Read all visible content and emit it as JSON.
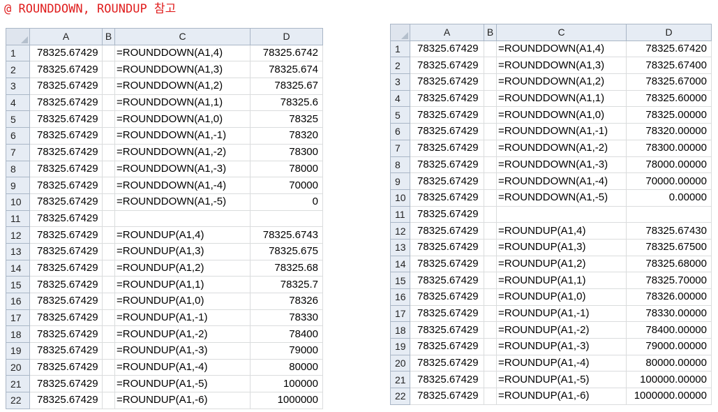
{
  "title": "@ ROUNDDOWN, ROUNDUP 참고",
  "columns": [
    "A",
    "B",
    "C",
    "D"
  ],
  "left_sheet": {
    "rows": [
      {
        "n": "1",
        "a": "78325.67429",
        "c": "=ROUNDDOWN(A1,4)",
        "d": "78325.6742"
      },
      {
        "n": "2",
        "a": "78325.67429",
        "c": "=ROUNDDOWN(A1,3)",
        "d": "78325.674"
      },
      {
        "n": "3",
        "a": "78325.67429",
        "c": "=ROUNDDOWN(A1,2)",
        "d": "78325.67"
      },
      {
        "n": "4",
        "a": "78325.67429",
        "c": "=ROUNDDOWN(A1,1)",
        "d": "78325.6"
      },
      {
        "n": "5",
        "a": "78325.67429",
        "c": "=ROUNDDOWN(A1,0)",
        "d": "78325"
      },
      {
        "n": "6",
        "a": "78325.67429",
        "c": "=ROUNDDOWN(A1,-1)",
        "d": "78320"
      },
      {
        "n": "7",
        "a": "78325.67429",
        "c": "=ROUNDDOWN(A1,-2)",
        "d": "78300"
      },
      {
        "n": "8",
        "a": "78325.67429",
        "c": "=ROUNDDOWN(A1,-3)",
        "d": "78000"
      },
      {
        "n": "9",
        "a": "78325.67429",
        "c": "=ROUNDDOWN(A1,-4)",
        "d": "70000"
      },
      {
        "n": "10",
        "a": "78325.67429",
        "c": "=ROUNDDOWN(A1,-5)",
        "d": "0"
      },
      {
        "n": "11",
        "a": "78325.67429",
        "c": "",
        "d": ""
      },
      {
        "n": "12",
        "a": "78325.67429",
        "c": "=ROUNDUP(A1,4)",
        "d": "78325.6743"
      },
      {
        "n": "13",
        "a": "78325.67429",
        "c": "=ROUNDUP(A1,3)",
        "d": "78325.675"
      },
      {
        "n": "14",
        "a": "78325.67429",
        "c": "=ROUNDUP(A1,2)",
        "d": "78325.68"
      },
      {
        "n": "15",
        "a": "78325.67429",
        "c": "=ROUNDUP(A1,1)",
        "d": "78325.7"
      },
      {
        "n": "16",
        "a": "78325.67429",
        "c": "=ROUNDUP(A1,0)",
        "d": "78326"
      },
      {
        "n": "17",
        "a": "78325.67429",
        "c": "=ROUNDUP(A1,-1)",
        "d": "78330"
      },
      {
        "n": "18",
        "a": "78325.67429",
        "c": "=ROUNDUP(A1,-2)",
        "d": "78400"
      },
      {
        "n": "19",
        "a": "78325.67429",
        "c": "=ROUNDUP(A1,-3)",
        "d": "79000"
      },
      {
        "n": "20",
        "a": "78325.67429",
        "c": "=ROUNDUP(A1,-4)",
        "d": "80000"
      },
      {
        "n": "21",
        "a": "78325.67429",
        "c": "=ROUNDUP(A1,-5)",
        "d": "100000"
      },
      {
        "n": "22",
        "a": "78325.67429",
        "c": "=ROUNDUP(A1,-6)",
        "d": "1000000"
      }
    ]
  },
  "right_sheet": {
    "rows": [
      {
        "n": "1",
        "a": "78325.67429",
        "c": "=ROUNDDOWN(A1,4)",
        "d": "78325.67420"
      },
      {
        "n": "2",
        "a": "78325.67429",
        "c": "=ROUNDDOWN(A1,3)",
        "d": "78325.67400"
      },
      {
        "n": "3",
        "a": "78325.67429",
        "c": "=ROUNDDOWN(A1,2)",
        "d": "78325.67000"
      },
      {
        "n": "4",
        "a": "78325.67429",
        "c": "=ROUNDDOWN(A1,1)",
        "d": "78325.60000"
      },
      {
        "n": "5",
        "a": "78325.67429",
        "c": "=ROUNDDOWN(A1,0)",
        "d": "78325.00000"
      },
      {
        "n": "6",
        "a": "78325.67429",
        "c": "=ROUNDDOWN(A1,-1)",
        "d": "78320.00000"
      },
      {
        "n": "7",
        "a": "78325.67429",
        "c": "=ROUNDDOWN(A1,-2)",
        "d": "78300.00000"
      },
      {
        "n": "8",
        "a": "78325.67429",
        "c": "=ROUNDDOWN(A1,-3)",
        "d": "78000.00000"
      },
      {
        "n": "9",
        "a": "78325.67429",
        "c": "=ROUNDDOWN(A1,-4)",
        "d": "70000.00000"
      },
      {
        "n": "10",
        "a": "78325.67429",
        "c": "=ROUNDDOWN(A1,-5)",
        "d": "0.00000"
      },
      {
        "n": "11",
        "a": "78325.67429",
        "c": "",
        "d": ""
      },
      {
        "n": "12",
        "a": "78325.67429",
        "c": "=ROUNDUP(A1,4)",
        "d": "78325.67430"
      },
      {
        "n": "13",
        "a": "78325.67429",
        "c": "=ROUNDUP(A1,3)",
        "d": "78325.67500"
      },
      {
        "n": "14",
        "a": "78325.67429",
        "c": "=ROUNDUP(A1,2)",
        "d": "78325.68000"
      },
      {
        "n": "15",
        "a": "78325.67429",
        "c": "=ROUNDUP(A1,1)",
        "d": "78325.70000"
      },
      {
        "n": "16",
        "a": "78325.67429",
        "c": "=ROUNDUP(A1,0)",
        "d": "78326.00000"
      },
      {
        "n": "17",
        "a": "78325.67429",
        "c": "=ROUNDUP(A1,-1)",
        "d": "78330.00000"
      },
      {
        "n": "18",
        "a": "78325.67429",
        "c": "=ROUNDUP(A1,-2)",
        "d": "78400.00000"
      },
      {
        "n": "19",
        "a": "78325.67429",
        "c": "=ROUNDUP(A1,-3)",
        "d": "79000.00000"
      },
      {
        "n": "20",
        "a": "78325.67429",
        "c": "=ROUNDUP(A1,-4)",
        "d": "80000.00000"
      },
      {
        "n": "21",
        "a": "78325.67429",
        "c": "=ROUNDUP(A1,-5)",
        "d": "100000.00000"
      },
      {
        "n": "22",
        "a": "78325.67429",
        "c": "=ROUNDUP(A1,-6)",
        "d": "1000000.00000"
      }
    ]
  }
}
